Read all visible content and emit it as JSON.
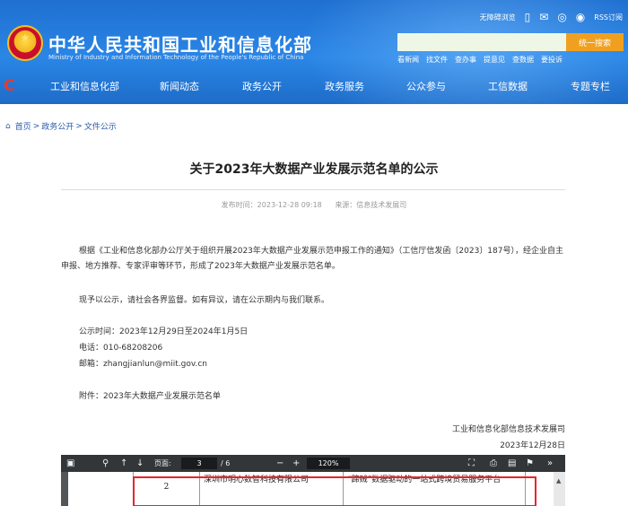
{
  "header": {
    "title": "中华人民共和国工业和信息化部",
    "subtitle": "Ministry of Industry and Information Technology of the People's Republic of China",
    "top_links": {
      "accessible": "无障碍浏览",
      "rss": "RSS订阅"
    },
    "search": {
      "placeholder": "",
      "button": "统一搜索"
    },
    "quick_links": [
      "看新闻",
      "找文件",
      "查办事",
      "提意见",
      "查数据",
      "要投诉"
    ],
    "nav": [
      "工业和信息化部",
      "新闻动态",
      "政务公开",
      "政务服务",
      "公众参与",
      "工信数据",
      "专题专栏"
    ]
  },
  "breadcrumb": [
    "首页",
    "政务公开",
    "文件公示"
  ],
  "breadcrumb_sep": ">",
  "article": {
    "title": "关于2023年大数据产业发展示范名单的公示",
    "published": "发布时间：2023-12-28 09:18",
    "source": "来源：信息技术发展司",
    "para1": "根据《工业和信息化部办公厅关于组织开展2023年大数据产业发展示范申报工作的通知》（工信厅信发函〔2023〕187号），经企业自主申报、地方推荐、专家评审等环节，形成了2023年大数据产业发展示范名单。",
    "para2": "现予以公示，请社会各界监督。如有异议，请在公示期内与我们联系。",
    "period": "公示时间：2023年12月29日至2024年1月5日",
    "phone": "电话：010-68208206",
    "email": "邮箱：zhangjianlun@miit.gov.cn",
    "attachment": "附件：2023年大数据产业发展示范名单",
    "signer": "工业和信息化部信息技术发展司",
    "date": "2023年12月28日"
  },
  "pdf": {
    "page_label": "页面:",
    "page_current": "3",
    "page_total": "/ 6",
    "zoom": "120%",
    "row": {
      "index": "2",
      "company": "深圳市明心数智科技有限公司",
      "project": "“蹄贼”数据驱动的一站式跨境贸易服务平台"
    }
  },
  "colors": {
    "header_blue": "#2a86e6",
    "search_btn": "#f0a020",
    "highlight_red": "#e8242b",
    "link_blue": "#2b5aa8"
  }
}
